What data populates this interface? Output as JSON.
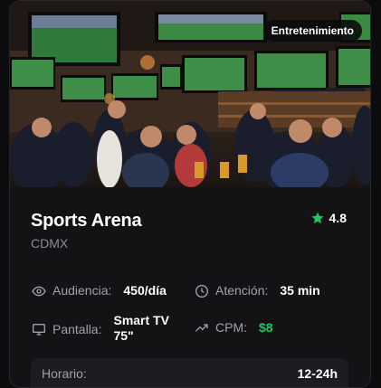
{
  "card": {
    "category_badge": "Entretenimiento",
    "image_alt": "Sports bar with many screens showing football",
    "title": "Sports Arena",
    "location": "CDMX",
    "rating": "4.8",
    "stats": {
      "audience": {
        "icon": "eye-icon",
        "label": "Audiencia:",
        "value": "450/día"
      },
      "attention": {
        "icon": "clock-icon",
        "label": "Atención:",
        "value": "35 min"
      },
      "screen": {
        "icon": "monitor-icon",
        "label": "Pantalla:",
        "value": "Smart TV 75\""
      },
      "cpm": {
        "icon": "trending-up-icon",
        "label": "CPM:",
        "value": "$8"
      }
    },
    "schedule": {
      "label": "Horario:",
      "value": "12-24h"
    }
  },
  "colors": {
    "accent_green": "#22c55e",
    "star": "#22c55e",
    "card_bg": "#131316"
  }
}
